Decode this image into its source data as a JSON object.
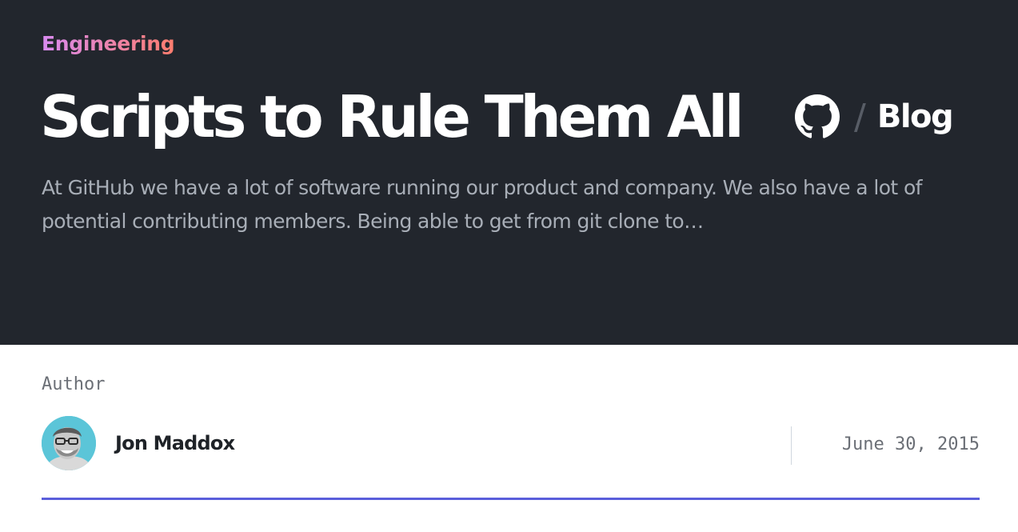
{
  "hero": {
    "category": "Engineering",
    "title": "Scripts to Rule Them All",
    "brand": {
      "slash": "/",
      "label": "Blog",
      "icon": "github-octocat-icon"
    },
    "excerpt": "At GitHub we have a lot of software running our product and company. We also have a lot of potential contributing members. Being able to get from git clone to…"
  },
  "meta": {
    "author_label": "Author",
    "author_name": "Jon Maddox",
    "avatar": "author-avatar-photo",
    "date": "June 30, 2015"
  },
  "colors": {
    "hero_background": "#22262d",
    "category_gradient_start": "#d88af0",
    "category_gradient_end": "#ff7d6e",
    "excerpt_text": "#a8aeb7",
    "avatar_background": "#5bc5d8",
    "accent_rule": "#5a5edb"
  }
}
